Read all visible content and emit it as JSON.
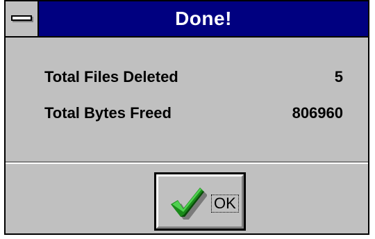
{
  "window": {
    "title": "Done!",
    "system_menu_icon": "system-menu-icon"
  },
  "stats": {
    "files_deleted_label": "Total Files Deleted",
    "files_deleted_value": "5",
    "bytes_freed_label": "Total Bytes Freed",
    "bytes_freed_value": "806960"
  },
  "ok_button": {
    "label": "OK",
    "icon": "checkmark-icon"
  },
  "colors": {
    "titlebar": "#000080",
    "face": "#c0c0c0",
    "check_green": "#1a8a1a"
  }
}
